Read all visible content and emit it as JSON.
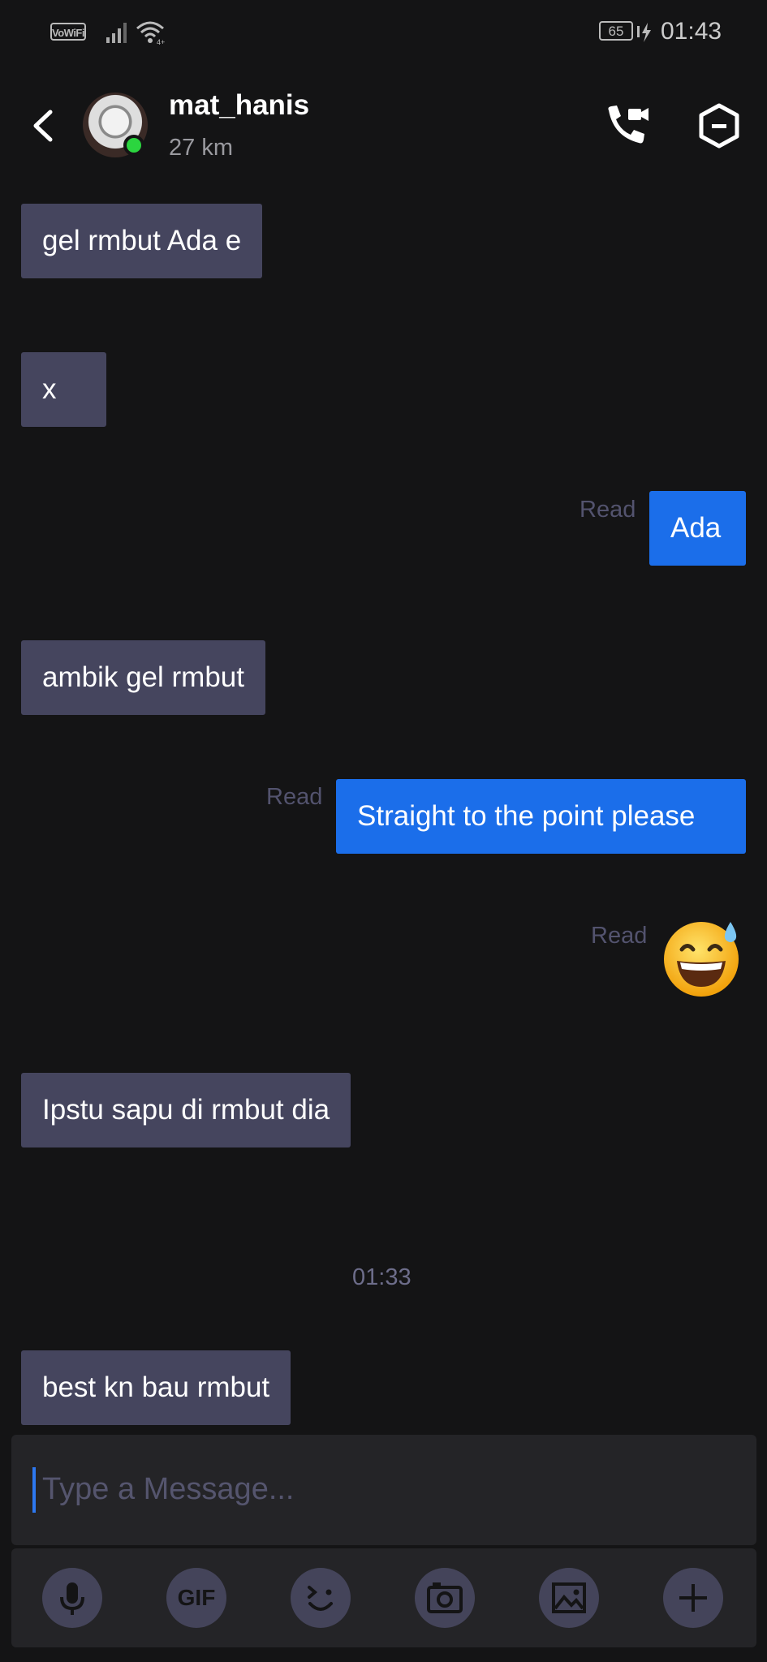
{
  "status_bar": {
    "vowifi_label": "VoWiFi",
    "battery_level": "65",
    "time": "01:43"
  },
  "header": {
    "contact_name": "mat_hanis",
    "distance": "27 km",
    "online": true
  },
  "messages": [
    {
      "direction": "in",
      "text": "gel rmbut Ada e"
    },
    {
      "direction": "in",
      "text": "x"
    },
    {
      "direction": "out",
      "text": "Ada",
      "status": "Read"
    },
    {
      "direction": "in",
      "text": "ambik gel rmbut"
    },
    {
      "direction": "out",
      "text": "Straight to the point please",
      "status": "Read"
    },
    {
      "direction": "out",
      "emoji": "grinning-face-with-sweat",
      "status": "Read"
    },
    {
      "direction": "in",
      "text": "Ipstu sapu di rmbut dia"
    },
    {
      "separator_time": "01:33"
    },
    {
      "direction": "in",
      "text": "best kn bau rmbut"
    }
  ],
  "composer": {
    "placeholder": "Type a Message..."
  },
  "toolbar": {
    "items": [
      "microphone-icon",
      "gif-icon",
      "emoji-icon",
      "camera-icon",
      "gallery-icon",
      "plus-icon"
    ],
    "gif_label": "GIF"
  },
  "colors": {
    "background": "#141415",
    "incoming_bubble": "#45455e",
    "outgoing_bubble": "#1b6eea",
    "online": "#2bd53f"
  }
}
